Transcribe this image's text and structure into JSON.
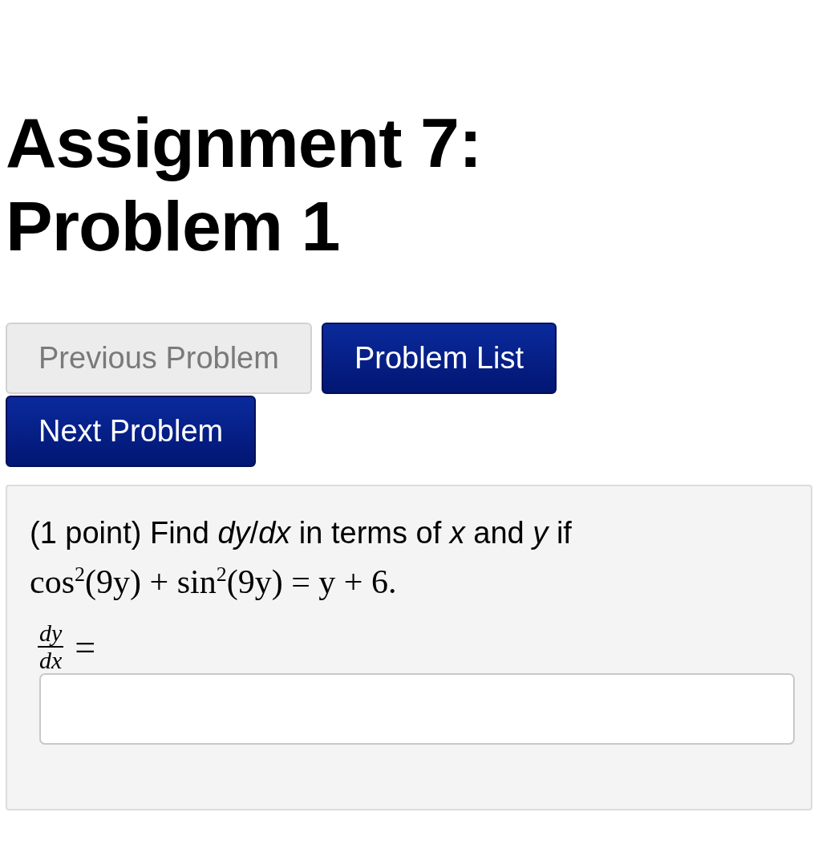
{
  "heading": "Assignment 7: Problem 1",
  "nav_buttons": [
    {
      "label": "Previous Problem",
      "disabled": true
    },
    {
      "label": "Problem List",
      "disabled": false
    },
    {
      "label": "Next Problem",
      "disabled": false
    }
  ],
  "problem": {
    "statement": "(1 point) Find *dy*/*dx* in terms of *x* and *y* if",
    "equation": "cos$^{2}$(9y) + sin$^{2}$(9y) = y + 6.",
    "answer_label": {
      "numerator": "dy",
      "denominator": "dx",
      "relation": "="
    }
  }
}
